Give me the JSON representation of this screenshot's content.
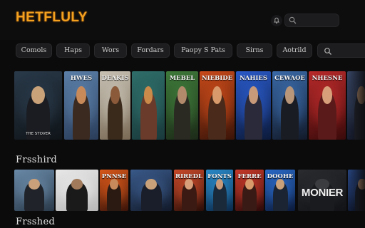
{
  "app": {
    "logo": "HETFLULY"
  },
  "header": {
    "notification_icon": "bell-icon",
    "search": {
      "placeholder": "",
      "icon": "search-icon"
    }
  },
  "genres": [
    {
      "label": "Comols"
    },
    {
      "label": "Haps"
    },
    {
      "label": "Wors"
    },
    {
      "label": "Fordars"
    },
    {
      "label": "Paopy S Pats"
    },
    {
      "label": "Sirns"
    },
    {
      "label": "Aotrild"
    }
  ],
  "rows": [
    {
      "title": "",
      "items": [
        {
          "title": "",
          "subtitle": "THE STOVER",
          "palette": [
            "#2a3a4a",
            "#0f1418",
            "#c9a27a",
            "#1a1c22"
          ]
        },
        {
          "title": "HWES",
          "subtitle": "",
          "palette": [
            "#5b7fa8",
            "#2a3d5a",
            "#c98a5a",
            "#3a2a20"
          ]
        },
        {
          "title": "DEAKIS",
          "subtitle": "",
          "palette": [
            "#c7c1b4",
            "#7a6a55",
            "#8a5a3a",
            "#3a2a1c"
          ]
        },
        {
          "title": "",
          "subtitle": "",
          "palette": [
            "#2f6e6a",
            "#1a3a3c",
            "#c98a4a",
            "#6a3a2a"
          ]
        },
        {
          "title": "MEBEL",
          "subtitle": "",
          "palette": [
            "#3e7a3a",
            "#1c2a18",
            "#b08a6a",
            "#2a2a22"
          ]
        },
        {
          "title": "NIEBIDE",
          "subtitle": "",
          "palette": [
            "#c84a1a",
            "#3a1408",
            "#d89a6a",
            "#4a2a1a"
          ]
        },
        {
          "title": "NAHIES",
          "subtitle": "",
          "palette": [
            "#2a5ac8",
            "#0c1a3a",
            "#c89a7a",
            "#2a2a3a"
          ]
        },
        {
          "title": "CEWAOE",
          "subtitle": "",
          "palette": [
            "#3a6aa8",
            "#121a2a",
            "#b8967a",
            "#1a1c24"
          ]
        },
        {
          "title": "NHESNE",
          "subtitle": "",
          "palette": [
            "#b82a2a",
            "#3a0a0a",
            "#d8a07a",
            "#5a1a1a"
          ]
        },
        {
          "title": "",
          "subtitle": "",
          "palette": [
            "#3a4a6a",
            "#14182a",
            "#b89070",
            "#20242e"
          ]
        }
      ]
    },
    {
      "title": "Frsshird",
      "items": [
        {
          "title": "",
          "subtitle": "",
          "palette": [
            "#6a8aa8",
            "#2a3a4a",
            "#c9a07a",
            "#20242a"
          ]
        },
        {
          "title": "",
          "subtitle": "",
          "palette": [
            "#e8e8e8",
            "#b8b8b8",
            "#a07a5a",
            "#1a1a1a"
          ]
        },
        {
          "title": "PNNSE",
          "subtitle": "",
          "palette": [
            "#d8581a",
            "#3a140a",
            "#c88a5a",
            "#2a1a12"
          ]
        },
        {
          "title": "",
          "subtitle": "",
          "palette": [
            "#3a5a8a",
            "#121a2a",
            "#c8a07a",
            "#1a1e2a"
          ]
        },
        {
          "title": "RIREDL",
          "subtitle": "",
          "palette": [
            "#c84a2a",
            "#2a0e08",
            "#d8a07a",
            "#3a1a12"
          ]
        },
        {
          "title": "FONTS",
          "subtitle": "",
          "palette": [
            "#2a8ac8",
            "#0c2a4a",
            "#c89a7a",
            "#1a2a3a"
          ]
        },
        {
          "title": "FERRE",
          "subtitle": "",
          "palette": [
            "#c83a2a",
            "#2a0a0a",
            "#d89a6a",
            "#3a1a14"
          ]
        },
        {
          "title": "DOOHE",
          "subtitle": "",
          "palette": [
            "#2a6ac8",
            "#0c1a3a",
            "#c8a07a",
            "#1a2432"
          ]
        },
        {
          "title": "",
          "subtitle": "",
          "big": "MONIER",
          "palette": [
            "#2a2c30",
            "#121316",
            "#3a3c40",
            "#1a1b1e"
          ]
        },
        {
          "title": "",
          "subtitle": "",
          "palette": [
            "#2a4a8a",
            "#0c142a",
            "#c89a7a",
            "#1a1e2a"
          ]
        }
      ]
    },
    {
      "title": "Frsshed",
      "items": []
    }
  ],
  "colors": {
    "accent": "#f3a11f",
    "background": "#0b0b0c",
    "chip": "#1d1d1f"
  }
}
